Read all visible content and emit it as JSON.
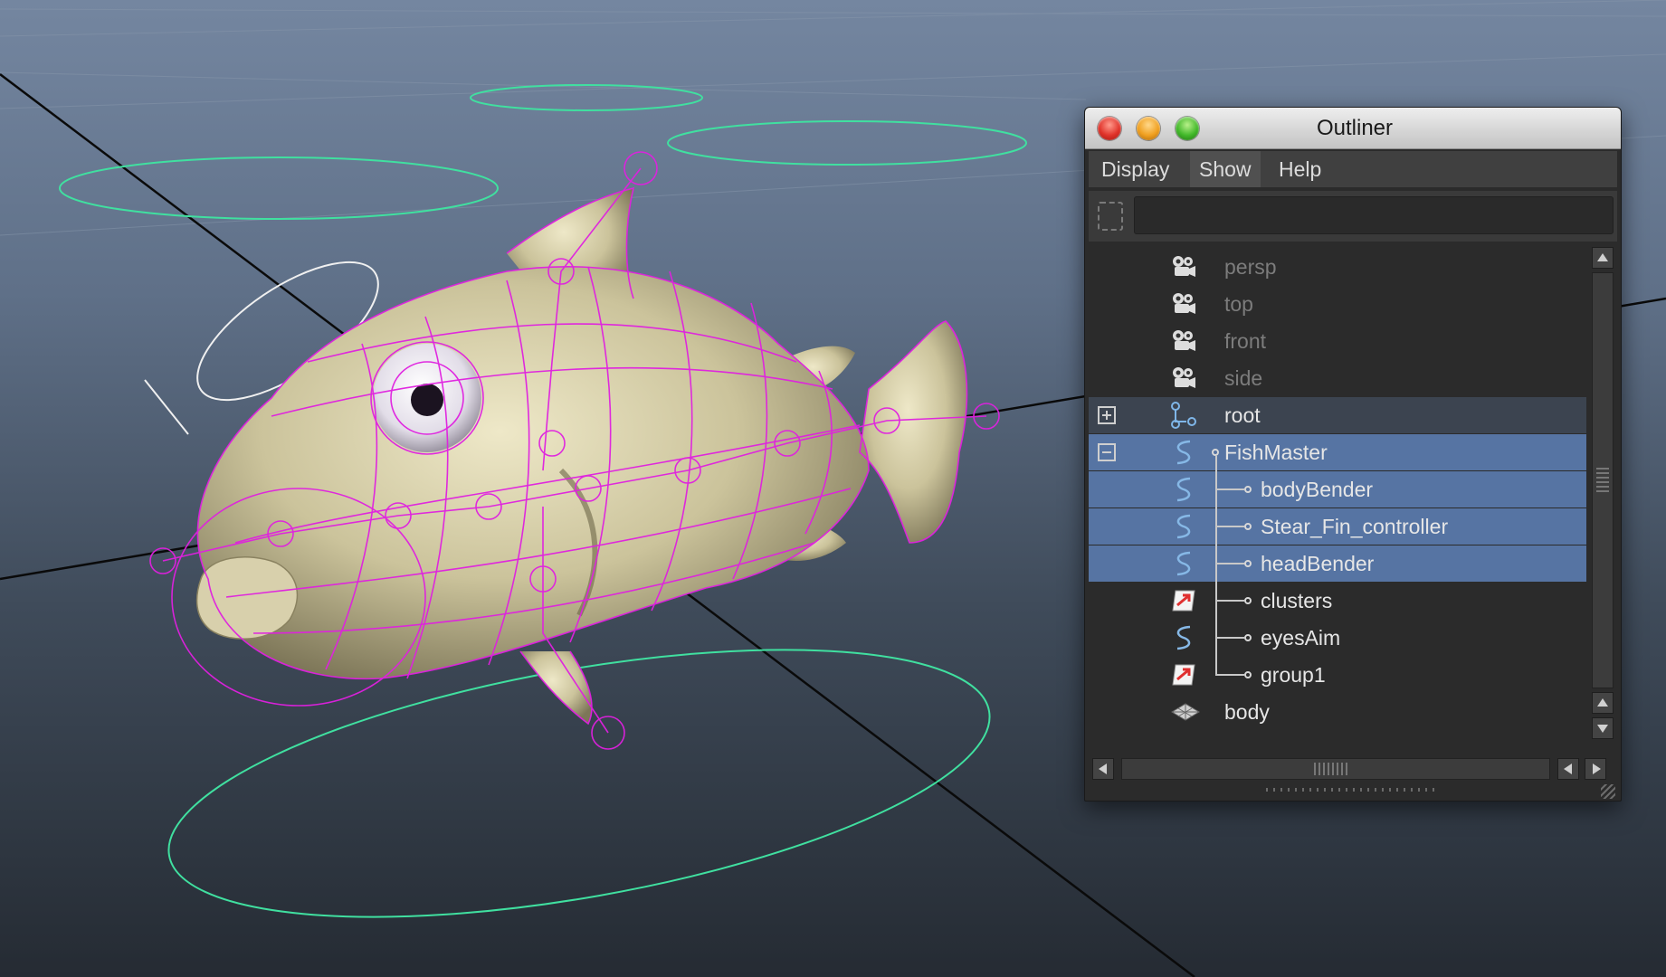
{
  "window": {
    "title": "Outliner"
  },
  "menu": {
    "display": "Display",
    "show": "Show",
    "help": "Help"
  },
  "filter": {
    "value": "",
    "placeholder": ""
  },
  "tree": {
    "items": [
      {
        "label": "persp",
        "icon": "camera-icon",
        "state": "dim"
      },
      {
        "label": "top",
        "icon": "camera-icon",
        "state": "dim"
      },
      {
        "label": "front",
        "icon": "camera-icon",
        "state": "dim"
      },
      {
        "label": "side",
        "icon": "camera-icon",
        "state": "dim"
      },
      {
        "label": "root",
        "icon": "joint-icon",
        "state": "collapsed"
      },
      {
        "label": "FishMaster",
        "icon": "curve-icon",
        "state": "selected-expanded"
      },
      {
        "label": "bodyBender",
        "icon": "curve-icon",
        "state": "selected"
      },
      {
        "label": "Stear_Fin_controller",
        "icon": "curve-icon",
        "state": "selected"
      },
      {
        "label": "headBender",
        "icon": "curve-icon",
        "state": "selected"
      },
      {
        "label": "clusters",
        "icon": "group-icon",
        "state": "normal"
      },
      {
        "label": "eyesAim",
        "icon": "curve-icon",
        "state": "normal"
      },
      {
        "label": "group1",
        "icon": "group-icon",
        "state": "normal"
      },
      {
        "label": "body",
        "icon": "mesh-icon",
        "state": "normal"
      }
    ]
  },
  "colors": {
    "selection": "#5674a3",
    "wireframe": "#e020e0",
    "controller_curves": "#40e0a0",
    "mesh_surface": "#d8d0a8"
  }
}
